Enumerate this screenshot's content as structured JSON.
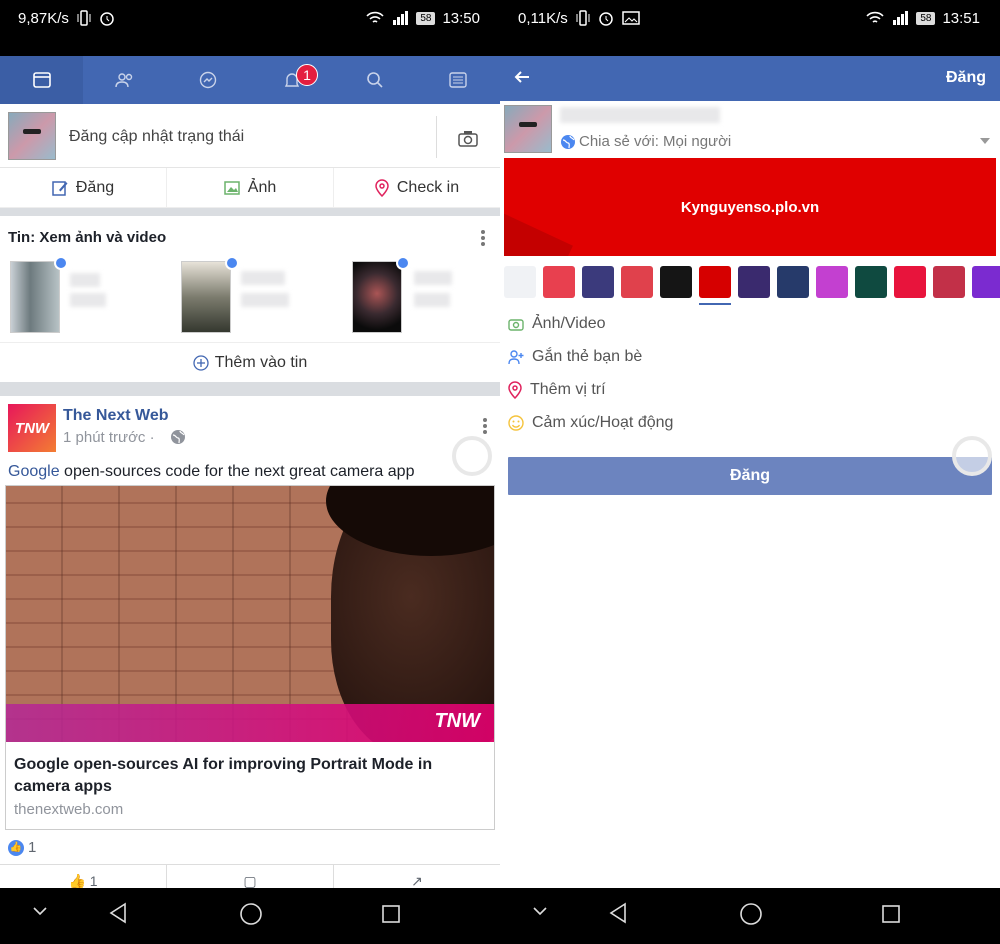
{
  "left": {
    "status": {
      "speed": "9,87K/s",
      "time": "13:50",
      "battery": "58"
    },
    "badge_count": "1",
    "composer_placeholder": "Đăng cập nhật trạng thái",
    "actions": [
      "Đăng",
      "Ảnh",
      "Check in"
    ],
    "stories_title": "Tin: Xem ảnh và video",
    "add_story": "Thêm vào tin",
    "post": {
      "page_name": "The Next Web",
      "logo_text": "TNW",
      "time": "1 phút trước",
      "separator": "·",
      "text_brand": "Google",
      "text_rest": " open-sources code for the next great camera app",
      "photo_logo": "TNW",
      "link_title": "Google open-sources AI for improving Portrait Mode in camera apps",
      "link_domain": "thenextweb.com",
      "like_count": "1",
      "like_action_count": "1"
    }
  },
  "right": {
    "status": {
      "speed": "0,11K/s",
      "time": "13:51",
      "battery": "58"
    },
    "header_post": "Đăng",
    "share_with": "Chia sẻ với: Mọi người",
    "banner_text": "Kynguyenso.plo.vn",
    "swatch_colors": [
      "#f0f2f5",
      "#e8404f",
      "#3b3a7c",
      "#e0414c",
      "#151515",
      "#d60000",
      "#3a2a6e",
      "#263a6a",
      "#c340d0",
      "#0f4a40",
      "#e8143c",
      "#c23048",
      "#7b2bd0"
    ],
    "options": [
      "Ảnh/Video",
      "Gắn thẻ bạn bè",
      "Thêm vị trí",
      "Cảm xúc/Hoạt động"
    ],
    "post_button": "Đăng"
  },
  "colors": {
    "fb_blue": "#4267b2",
    "link_blue": "#365899",
    "badge_red": "#e41e3f"
  }
}
